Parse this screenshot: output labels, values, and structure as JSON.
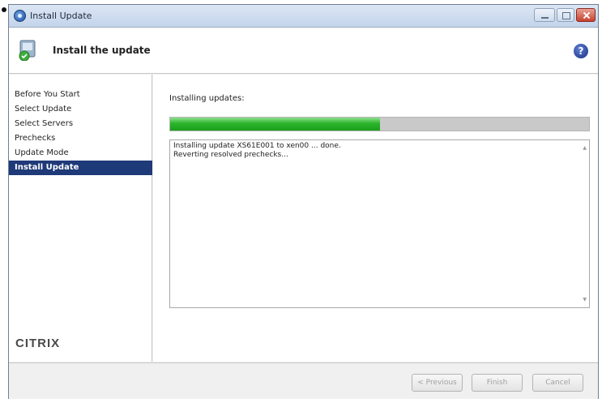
{
  "window": {
    "title": "Install Update"
  },
  "header": {
    "title": "Install the update",
    "help_icon": "?"
  },
  "sidebar": {
    "items": [
      {
        "label": "Before You Start",
        "active": false
      },
      {
        "label": "Select Update",
        "active": false
      },
      {
        "label": "Select Servers",
        "active": false
      },
      {
        "label": "Prechecks",
        "active": false
      },
      {
        "label": "Update Mode",
        "active": false
      },
      {
        "label": "Install Update",
        "active": true
      }
    ],
    "logo": "CITRIX"
  },
  "main": {
    "status_label": "Installing updates:",
    "progress_percent": 50,
    "log_lines": [
      "Installing update XS61E001 to xen00 ... done.",
      "Reverting resolved prechecks..."
    ]
  },
  "footer": {
    "previous_label": "< Previous",
    "finish_label": "Finish",
    "cancel_label": "Cancel"
  },
  "colors": {
    "accent": "#1f3a78",
    "progress": "#2bb52b"
  }
}
